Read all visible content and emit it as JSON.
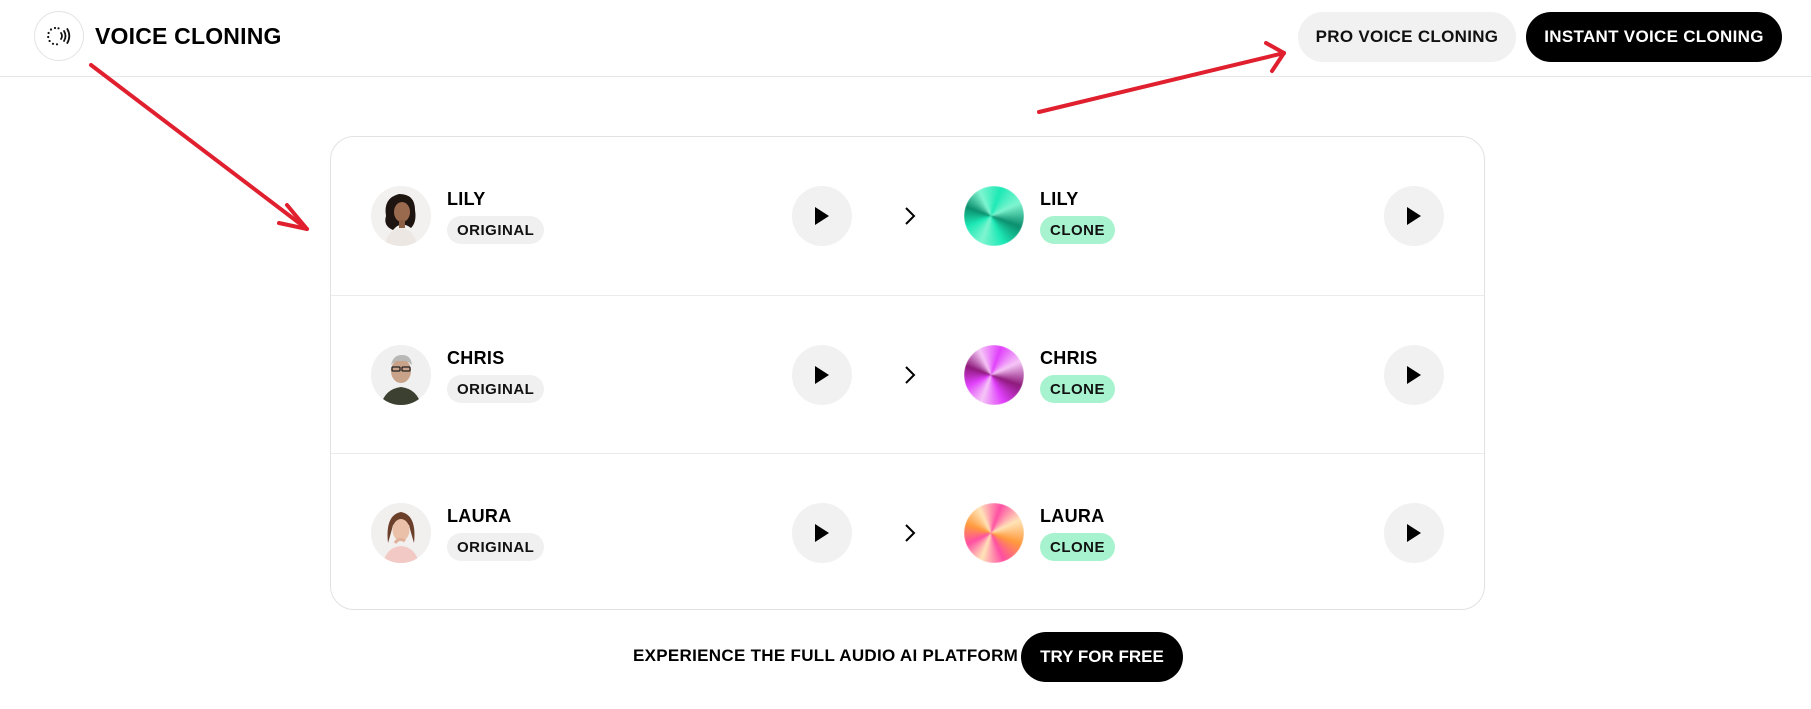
{
  "header": {
    "logo_icon": "voice-wave-icon",
    "title": "VOICE CLONING",
    "buttons": {
      "pro": "PRO VOICE CLONING",
      "instant": "INSTANT VOICE CLONING"
    }
  },
  "rows": [
    {
      "original": {
        "name": "LILY",
        "badge": "ORIGINAL",
        "avatar": "photo-woman-curly-hair"
      },
      "clone": {
        "name": "LILY",
        "badge": "CLONE",
        "orb_colors": [
          "#1de9b6",
          "#0b8f6e",
          "#7ff5d0"
        ]
      }
    },
    {
      "original": {
        "name": "CHRIS",
        "badge": "ORIGINAL",
        "avatar": "photo-man-glasses"
      },
      "clone": {
        "name": "CHRIS",
        "badge": "CLONE",
        "orb_colors": [
          "#e040fb",
          "#8e1a7c",
          "#f6c6f7"
        ]
      }
    },
    {
      "original": {
        "name": "LAURA",
        "badge": "ORIGINAL",
        "avatar": "photo-woman-long-hair"
      },
      "clone": {
        "name": "LAURA",
        "badge": "CLONE",
        "orb_colors": [
          "#ff4fa3",
          "#ff9a3c",
          "#ffe4b8"
        ]
      }
    }
  ],
  "icons": {
    "play": "play-icon",
    "chevron": "chevron-right-icon"
  },
  "colors": {
    "clone_badge_bg": "#a8f3cf",
    "original_badge_bg": "#f0f0f0",
    "annotation_arrow": "#e0202f"
  },
  "footer": {
    "text": "EXPERIENCE THE FULL AUDIO AI PLATFORM",
    "cta": "TRY FOR FREE"
  }
}
